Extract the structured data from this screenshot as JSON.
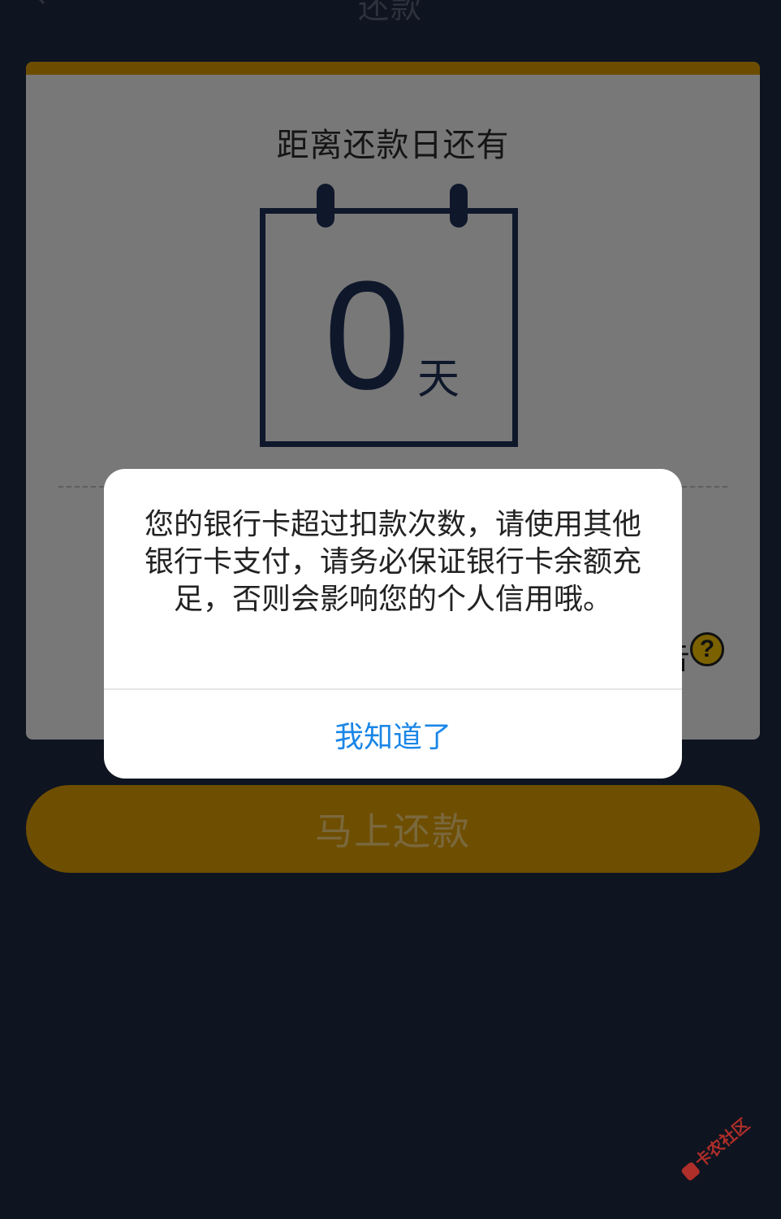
{
  "header": {
    "title": "还款",
    "back_icon": "chevron-left-icon"
  },
  "card": {
    "heading": "距离还款日还有",
    "days_remaining": "0",
    "days_unit": "天",
    "side_text": "告",
    "help_icon": "question-circle-icon",
    "help_symbol": "?",
    "accent_color": "#d99a00"
  },
  "pay_button": {
    "label": "马上还款"
  },
  "dialog": {
    "message": "您的银行卡超过扣款次数，请使用其他银行卡支付，请务必保证银行卡余额充足，否则会影响您的个人信用哦。",
    "confirm_label": "我知道了",
    "link_color": "#1a86e8"
  },
  "watermark": {
    "text": "卡农社区"
  }
}
